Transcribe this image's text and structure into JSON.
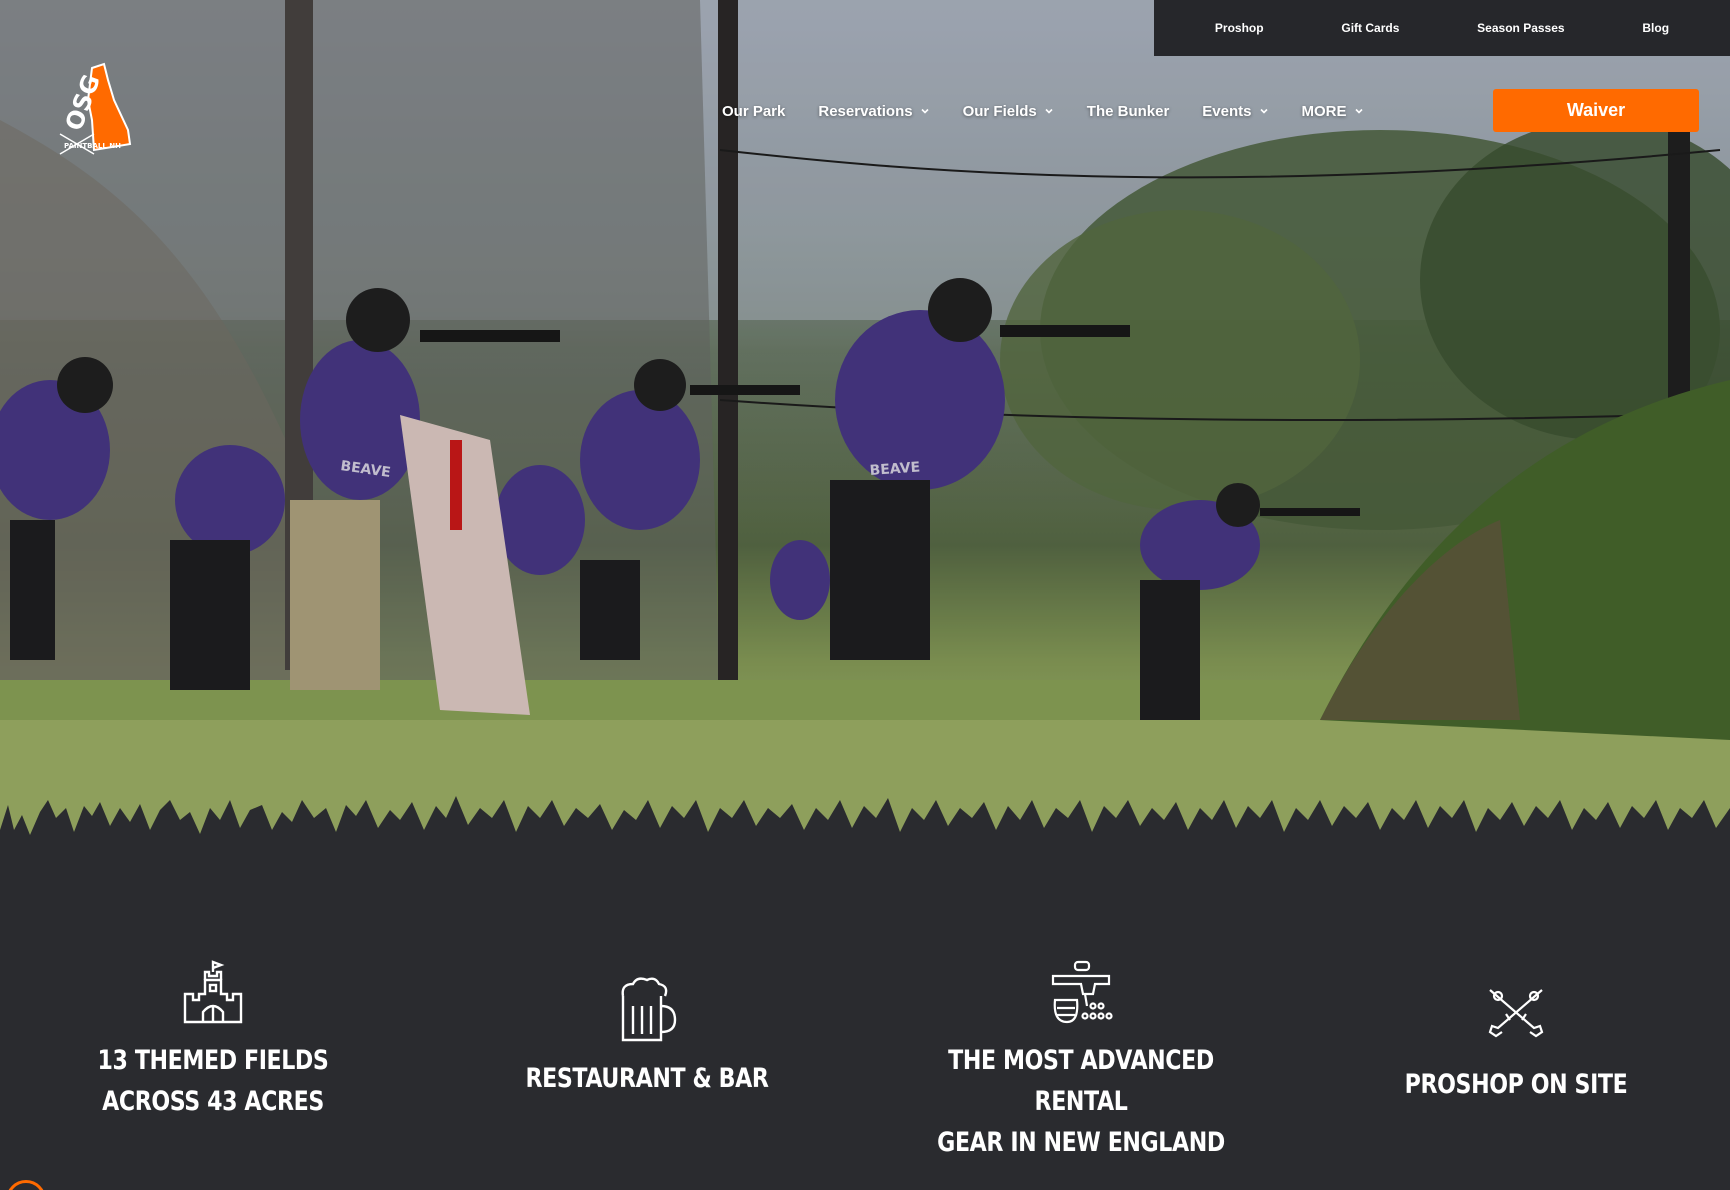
{
  "brand": {
    "logo_text": "OSG",
    "logo_subtext": "PAINTBALL NH",
    "accent_color": "#ff6a00",
    "dark_bg": "#2a2b2f"
  },
  "utility_nav": {
    "links": [
      "Proshop",
      "Gift Cards",
      "Season Passes",
      "Blog"
    ]
  },
  "main_nav": {
    "items": [
      {
        "label": "Our Park",
        "has_dropdown": false
      },
      {
        "label": "Reservations",
        "has_dropdown": true
      },
      {
        "label": "Our Fields",
        "has_dropdown": true
      },
      {
        "label": "The Bunker",
        "has_dropdown": false
      },
      {
        "label": "Events",
        "has_dropdown": true
      },
      {
        "label": "MORE",
        "has_dropdown": true
      }
    ],
    "cta_label": "Waiver"
  },
  "hero": {
    "jersey_text_1": "BEAVE",
    "jersey_text_2": "BEAVE"
  },
  "features": [
    {
      "icon": "castle-icon",
      "title": "13 THEMED FIELDS\nACROSS 43 ACRES"
    },
    {
      "icon": "beer-mug-icon",
      "title": "RESTAURANT & BAR"
    },
    {
      "icon": "rental-gear-icon",
      "title": "THE MOST ADVANCED RENTAL\nGEAR IN NEW ENGLAND"
    },
    {
      "icon": "crossed-markers-icon",
      "title": "PROSHOP ON SITE"
    }
  ]
}
